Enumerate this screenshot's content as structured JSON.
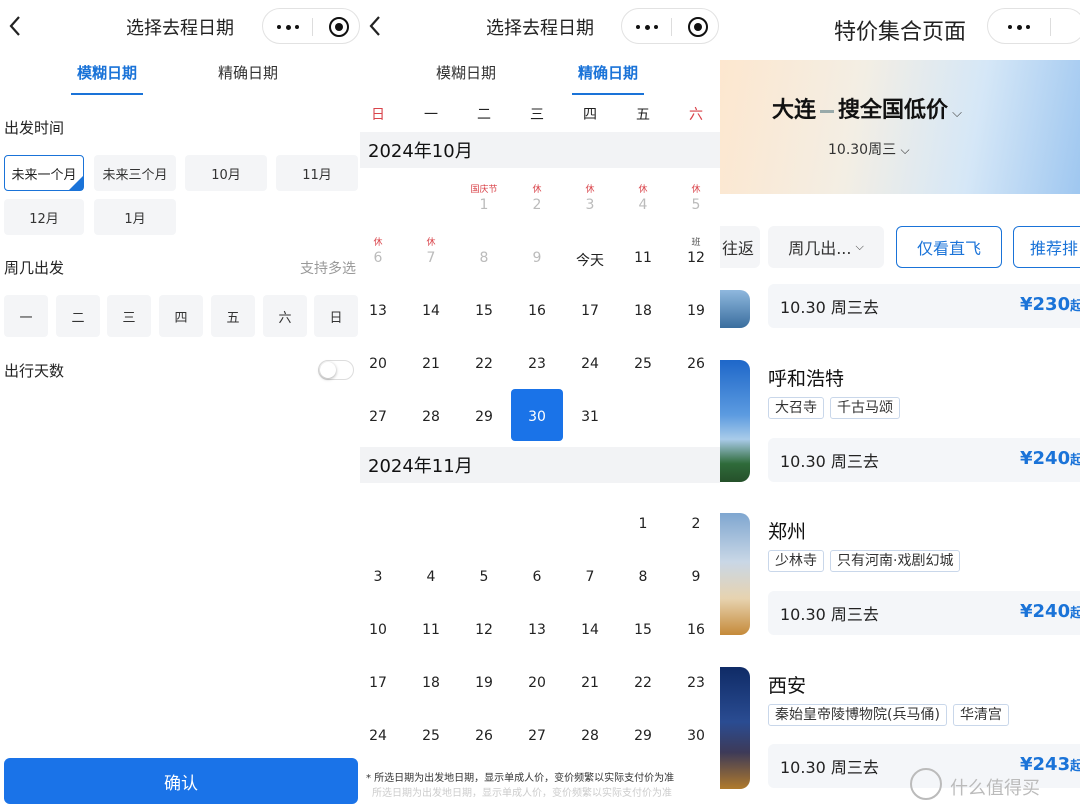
{
  "panel1": {
    "title": "选择去程日期",
    "tabs": [
      "模糊日期",
      "精确日期"
    ],
    "depart_section": "出发时间",
    "period_chips": [
      "未来一个月",
      "未来三个月",
      "10月",
      "11月",
      "12月",
      "1月"
    ],
    "selected_chip": "未来一个月",
    "weekday_section": "周几出发",
    "weekday_hint": "支持多选",
    "weekday_chips": [
      "一",
      "二",
      "三",
      "四",
      "五",
      "六",
      "日"
    ],
    "days_section": "出行天数",
    "days_toggle_on": false,
    "confirm": "确认"
  },
  "panel2": {
    "title": "选择去程日期",
    "tabs": [
      "模糊日期",
      "精确日期"
    ],
    "weekdays": [
      "日",
      "一",
      "二",
      "三",
      "四",
      "五",
      "六"
    ],
    "october": {
      "label": "2024年10月",
      "rows": [
        [
          null,
          null,
          {
            "n": "1",
            "tag": "国庆节",
            "gray": true
          },
          {
            "n": "2",
            "tag": "休",
            "gray": true
          },
          {
            "n": "3",
            "tag": "休",
            "gray": true
          },
          {
            "n": "4",
            "tag": "休",
            "gray": true
          },
          {
            "n": "5",
            "tag": "休",
            "gray": true
          }
        ],
        [
          {
            "n": "6",
            "tag": "休",
            "gray": true
          },
          {
            "n": "7",
            "tag": "休",
            "gray": true
          },
          {
            "n": "8",
            "gray": true
          },
          {
            "n": "9",
            "gray": true
          },
          {
            "n": "今天"
          },
          {
            "n": "11"
          },
          {
            "n": "12",
            "tag": "班",
            "tagDark": true
          }
        ],
        [
          {
            "n": "13"
          },
          {
            "n": "14"
          },
          {
            "n": "15"
          },
          {
            "n": "16"
          },
          {
            "n": "17"
          },
          {
            "n": "18"
          },
          {
            "n": "19"
          }
        ],
        [
          {
            "n": "20"
          },
          {
            "n": "21"
          },
          {
            "n": "22"
          },
          {
            "n": "23"
          },
          {
            "n": "24"
          },
          {
            "n": "25"
          },
          {
            "n": "26"
          }
        ],
        [
          {
            "n": "27"
          },
          {
            "n": "28"
          },
          {
            "n": "29"
          },
          {
            "n": "30",
            "sel": true
          },
          {
            "n": "31"
          },
          null,
          null
        ]
      ]
    },
    "november": {
      "label": "2024年11月",
      "rows": [
        [
          null,
          null,
          null,
          null,
          null,
          {
            "n": "1"
          },
          {
            "n": "2"
          }
        ],
        [
          {
            "n": "3"
          },
          {
            "n": "4"
          },
          {
            "n": "5"
          },
          {
            "n": "6"
          },
          {
            "n": "7"
          },
          {
            "n": "8"
          },
          {
            "n": "9"
          }
        ],
        [
          {
            "n": "10"
          },
          {
            "n": "11"
          },
          {
            "n": "12"
          },
          {
            "n": "13"
          },
          {
            "n": "14"
          },
          {
            "n": "15"
          },
          {
            "n": "16"
          }
        ],
        [
          {
            "n": "17"
          },
          {
            "n": "18"
          },
          {
            "n": "19"
          },
          {
            "n": "20"
          },
          {
            "n": "21"
          },
          {
            "n": "22"
          },
          {
            "n": "23"
          }
        ],
        [
          {
            "n": "24"
          },
          {
            "n": "25"
          },
          {
            "n": "26"
          },
          {
            "n": "27"
          },
          {
            "n": "28"
          },
          {
            "n": "29"
          },
          {
            "n": "30"
          }
        ]
      ]
    },
    "footnote": "* 所选日期为出发地日期，显示单成人价，变价频繁以实际支付价为准",
    "footnote_ghost": "所选日期为出发地日期，显示单成人价，变价频繁以实际支付价为准"
  },
  "panel3": {
    "title": "特价集合页面",
    "origin": "大连",
    "destination": "搜全国低价",
    "date": "10.30周三",
    "filters": [
      "往返",
      "周几出...",
      "仅看直飞",
      "推荐排"
    ],
    "first_fare": {
      "date": "10.30",
      "weekday": "周三去",
      "price": "¥230",
      "suffix": "起"
    },
    "cities": [
      {
        "name": "呼和浩特",
        "tags": [
          "大召寺",
          "千古马颂"
        ],
        "date": "10.30",
        "weekday": "周三去",
        "price": "¥240",
        "suffix": "起"
      },
      {
        "name": "郑州",
        "tags": [
          "少林寺",
          "只有河南·戏剧幻城"
        ],
        "date": "10.30",
        "weekday": "周三去",
        "price": "¥240",
        "suffix": "起"
      },
      {
        "name": "西安",
        "tags": [
          "秦始皇帝陵博物院(兵马俑)",
          "华清宫"
        ],
        "date": "10.30",
        "weekday": "周三去",
        "price": "¥243",
        "suffix": "起"
      }
    ],
    "watermark": "什么值得买"
  },
  "colors": {
    "accent": "#1a73e8",
    "holiday": "#d9434a"
  }
}
